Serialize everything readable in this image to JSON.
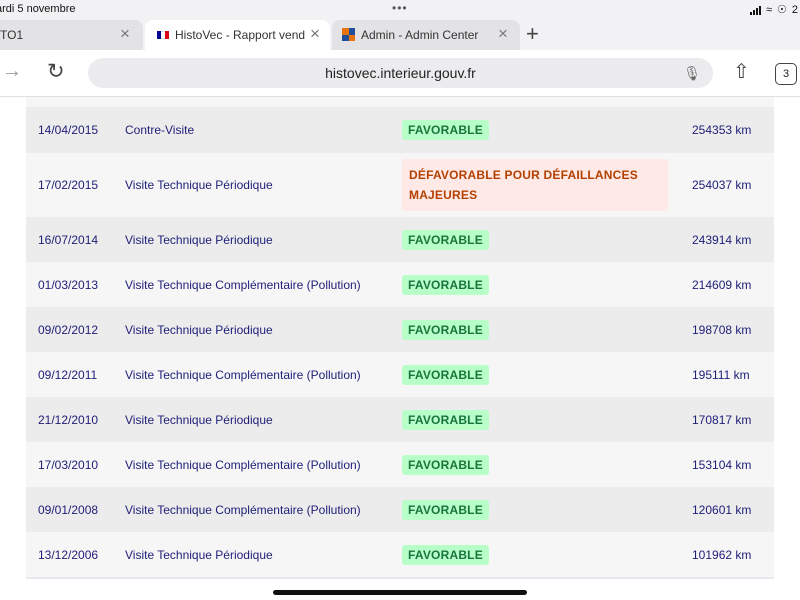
{
  "status_bar": {
    "date": "ardi 5 novembre",
    "dots": "•••",
    "battery_partial": "2"
  },
  "tabs": [
    {
      "label": "TO1",
      "active": false
    },
    {
      "label": "HistoVec - Rapport vendeur",
      "active": true
    },
    {
      "label": "Admin - Admin Center",
      "active": false
    }
  ],
  "toolbar": {
    "url": "histovec.interieur.gouv.fr",
    "tab_count": "3"
  },
  "icons": {
    "close": "close-icon",
    "new_tab": "plus-icon",
    "forward": "forward-arrow-icon",
    "reload": "reload-icon",
    "mic": "microphone-icon",
    "share": "share-icon"
  },
  "colors": {
    "favorable_bg": "#b8fec9",
    "favorable_text": "#18753c",
    "defavorable_bg": "#ffe9e6",
    "defavorable_text": "#b34000",
    "row_text": "#1e1e78"
  },
  "inspections": [
    {
      "date": "14/04/2015",
      "type": "Contre-Visite",
      "result": "FAVORABLE",
      "status": "ok",
      "km": "254353 km"
    },
    {
      "date": "17/02/2015",
      "type": "Visite Technique Périodique",
      "result": "DÉFAVORABLE POUR DÉFAILLANCES MAJEURES",
      "status": "ko",
      "km": "254037 km"
    },
    {
      "date": "16/07/2014",
      "type": "Visite Technique Périodique",
      "result": "FAVORABLE",
      "status": "ok",
      "km": "243914 km"
    },
    {
      "date": "01/03/2013",
      "type": "Visite Technique Complémentaire (Pollution)",
      "result": "FAVORABLE",
      "status": "ok",
      "km": "214609 km"
    },
    {
      "date": "09/02/2012",
      "type": "Visite Technique Périodique",
      "result": "FAVORABLE",
      "status": "ok",
      "km": "198708 km"
    },
    {
      "date": "09/12/2011",
      "type": "Visite Technique Complémentaire (Pollution)",
      "result": "FAVORABLE",
      "status": "ok",
      "km": "195111 km"
    },
    {
      "date": "21/12/2010",
      "type": "Visite Technique Périodique",
      "result": "FAVORABLE",
      "status": "ok",
      "km": "170817 km"
    },
    {
      "date": "17/03/2010",
      "type": "Visite Technique Complémentaire (Pollution)",
      "result": "FAVORABLE",
      "status": "ok",
      "km": "153104 km"
    },
    {
      "date": "09/01/2008",
      "type": "Visite Technique Complémentaire (Pollution)",
      "result": "FAVORABLE",
      "status": "ok",
      "km": "120601 km"
    },
    {
      "date": "13/12/2006",
      "type": "Visite Technique Périodique",
      "result": "FAVORABLE",
      "status": "ok",
      "km": "101962 km"
    }
  ]
}
